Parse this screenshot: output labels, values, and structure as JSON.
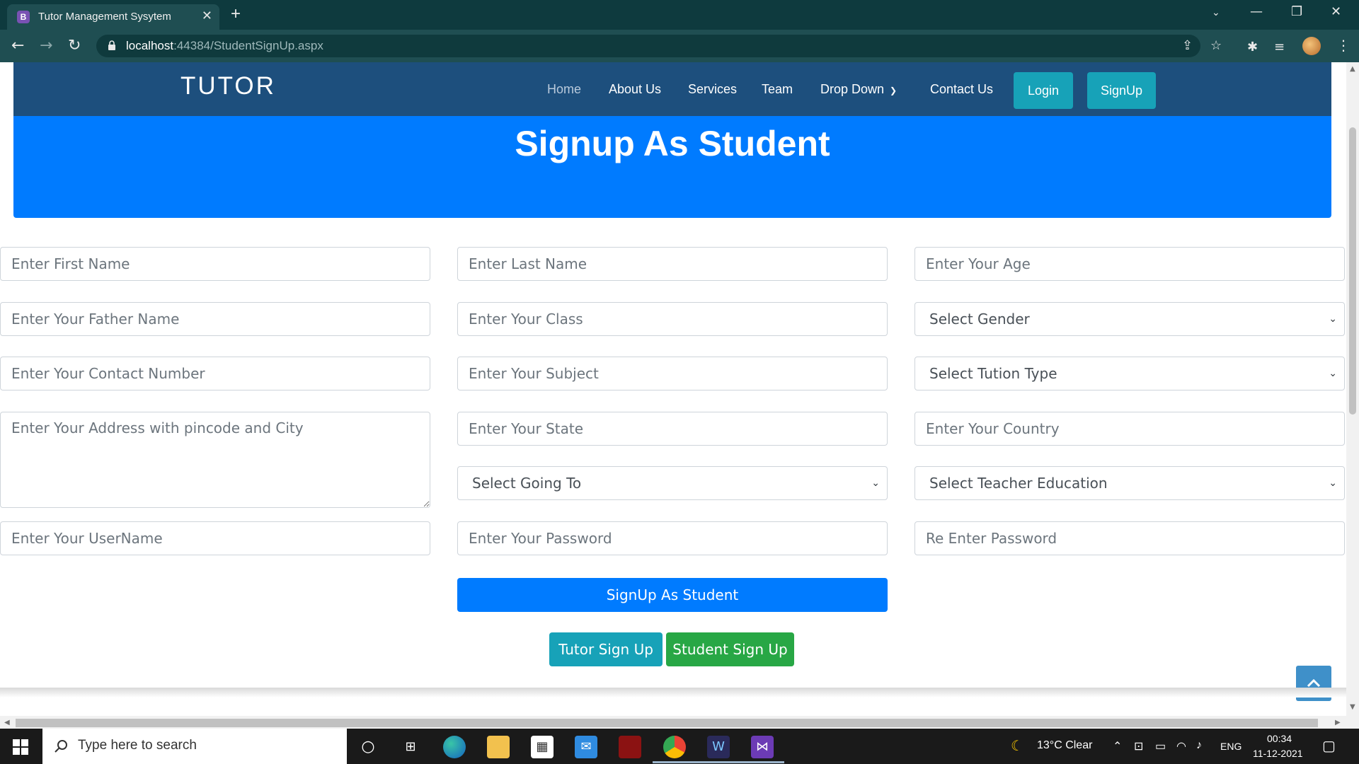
{
  "browser": {
    "tab_title": "Tutor Management Sysytem",
    "tab_favicon": "B",
    "url_host": "localhost",
    "url_rest": ":44384/StudentSignUp.aspx"
  },
  "site": {
    "brand": "TUTOR",
    "nav": [
      "Home",
      "About Us",
      "Services",
      "Team",
      "Drop Down",
      "Contact Us"
    ],
    "login": "Login",
    "signup": "SignUp"
  },
  "hero": {
    "title": "Signup As Student"
  },
  "form": {
    "first_name": "Enter First Name",
    "last_name": "Enter Last Name",
    "age": "Enter Your Age",
    "father_name": "Enter Your Father Name",
    "class": "Enter Your Class",
    "gender": "Select Gender",
    "contact": "Enter Your Contact Number",
    "subject": "Enter Your Subject",
    "tution_type": "Select Tution Type",
    "address": "Enter Your Address with pincode and City",
    "state": "Enter Your State",
    "country": "Enter Your Country",
    "going_to": "Select Going To",
    "teacher_education": "Select Teacher Education",
    "username": "Enter Your UserName",
    "password": "Enter Your Password",
    "re_password": "Re Enter Password",
    "submit": "SignUp As Student",
    "tutor_signup": "Tutor Sign Up",
    "student_signup": "Student Sign Up"
  },
  "taskbar": {
    "search_placeholder": "Type here to search",
    "weather": "13°C  Clear",
    "language": "ENG",
    "time": "00:34",
    "date": "11-12-2021"
  },
  "colors": {
    "tab_bar": "#0e3a3e",
    "address_bar": "#1f4e52",
    "nav_bg": "#1d4f7d",
    "hero_bg": "#007bff",
    "info_btn": "#17a2b8",
    "success_btn": "#28a745",
    "primary_btn": "#007bff"
  }
}
